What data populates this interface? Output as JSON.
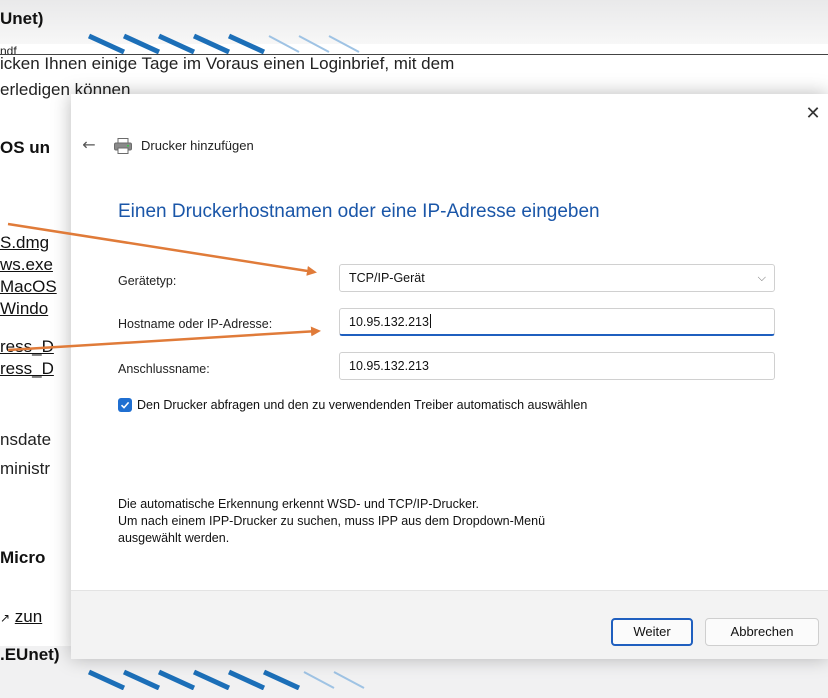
{
  "background": {
    "heading_top": "Unet)",
    "text_line1": "ndf",
    "text_line2": "icken Ihnen einige Tage im Voraus einen Loginbrief, mit dem",
    "text_line3": "erledigen können",
    "heading_os": "OS un",
    "links": [
      "S.dmg",
      "ws.exe",
      "MacOS",
      "Windo",
      "ress_D",
      "ress_D"
    ],
    "text_after_links1": "nsdate",
    "text_after_links2": "ministr",
    "heading_micro": "Micro",
    "external_link_text": "zun",
    "heading_bottom": ".EUnet)"
  },
  "dialog": {
    "title": "Drucker hinzufügen",
    "heading": "Einen Druckerhostnamen oder eine IP-Adresse eingeben",
    "fields": {
      "device_type_label": "Gerätetyp:",
      "device_type_value": "TCP/IP-Gerät",
      "hostname_label": "Hostname oder IP-Adresse:",
      "hostname_value": "10.95.132.213",
      "port_label": "Anschlussname:",
      "port_value": "10.95.132.213"
    },
    "checkbox_label": "Den Drucker abfragen und den zu verwendenden Treiber automatisch auswählen",
    "checkbox_checked": true,
    "info_line1": "Die automatische Erkennung erkennt WSD- und TCP/IP-Drucker.",
    "info_line2": "Um nach einem IPP-Drucker zu suchen, muss IPP aus dem Dropdown-Menü",
    "info_line3": "ausgewählt werden.",
    "next_button": "Weiter",
    "cancel_button": "Abbrechen",
    "close_glyph": "✕",
    "back_glyph": "←"
  },
  "colors": {
    "accent": "#1f5fbf",
    "heading_blue": "#1a56a8",
    "annotation_arrow": "#e07b39"
  }
}
